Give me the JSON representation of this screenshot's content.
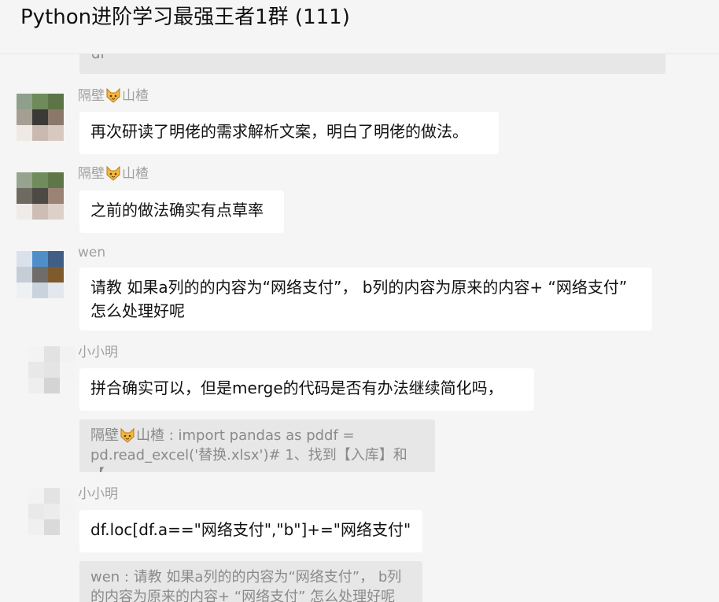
{
  "header": {
    "title": "Python进阶学习最强王者1群 (111)"
  },
  "messages": [
    {
      "sender_prefix": "隔壁",
      "sender_suffix": "山楂",
      "text": "再次研读了明佬的需求解析文案，明白了明佬的做法。"
    },
    {
      "sender_prefix": "隔壁",
      "sender_suffix": "山楂",
      "text": "之前的做法确实有点草率"
    },
    {
      "sender_prefix": "wen",
      "sender_suffix": "",
      "text": "请教 如果a列的的内容为“网络支付”， b列的内容为原来的内容+ “网络支付” 怎么处理好呢"
    },
    {
      "sender_prefix": "小小明",
      "sender_suffix": "",
      "text": "拼合确实可以，但是merge的代码是否有办法继续简化吗，",
      "quote_prefix": "隔壁",
      "quote_rest": "山楂 : import pandas as pddf = pd.read_excel('替换.xlsx')# 1、找到【入库】和【..."
    },
    {
      "sender_prefix": "小小明",
      "sender_suffix": "",
      "text": "df.loc[df.a==\"网络支付\",\"b\"]+=\"网络支付\"",
      "quote_text": "wen : 请教 如果a列的的内容为“网络支付”， b列的内容为原来的内容+ “网络支付” 怎么处理好呢"
    }
  ],
  "partial_top": {
    "text": "df"
  },
  "colors": {
    "background": "#f5f5f5",
    "bubble": "#ffffff",
    "quote": "#e7e7e7",
    "sender": "#a0a0a0",
    "quote_text": "#8a8a8a"
  }
}
